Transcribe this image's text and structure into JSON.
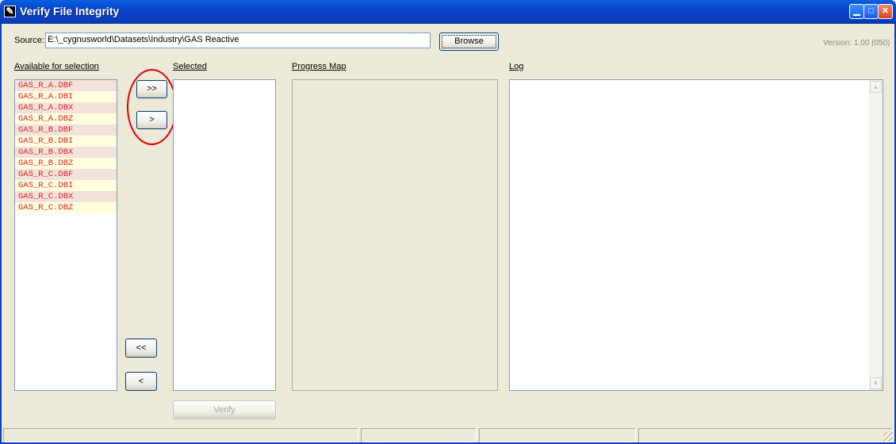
{
  "window": {
    "title": "Verify File Integrity"
  },
  "source": {
    "label": "Source:",
    "value": "E:\\_cygnusworld\\Datasets\\Industry\\GAS Reactive",
    "browse_label": "Browse"
  },
  "version": "Version: 1.00 (050)",
  "available": {
    "label": "Available for selection",
    "items": [
      "GAS_R_A.DBF",
      "GAS_R_A.DBI",
      "GAS_R_A.DBX",
      "GAS_R_A.DBZ",
      "GAS_R_B.DBF",
      "GAS_R_B.DBI",
      "GAS_R_B.DBX",
      "GAS_R_B.DBZ",
      "GAS_R_C.DBF",
      "GAS_R_C.DBI",
      "GAS_R_C.DBX",
      "GAS_R_C.DBZ"
    ]
  },
  "transfer": {
    "add_all": ">>",
    "add_one": ">",
    "remove_all": "<<",
    "remove_one": "<"
  },
  "selected": {
    "label": "Selected",
    "items": []
  },
  "progress": {
    "label": "Progress Map"
  },
  "log": {
    "label": "Log"
  },
  "verify": {
    "label": "Verify"
  },
  "icons": {
    "app": "app-icon",
    "minimize": "minimize-icon",
    "maximize": "maximize-icon",
    "close": "close-icon"
  }
}
